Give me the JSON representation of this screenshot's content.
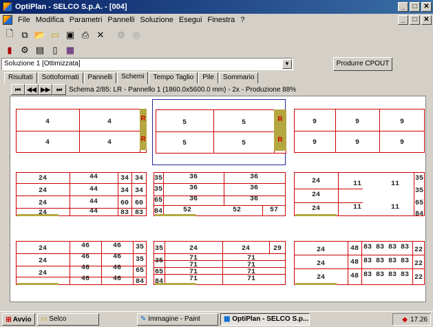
{
  "window": {
    "title": "OptiPlan - SELCO S.p.A. - [004]",
    "minimize": "_",
    "maximize": "□",
    "close": "✕"
  },
  "menu": [
    "File",
    "Modifica",
    "Parametri",
    "Pannelli",
    "Soluzione",
    "Esegui",
    "Finestra",
    "?"
  ],
  "toolbar1": [
    "new-icon",
    "copy-icon",
    "open-icon",
    "folder-icon",
    "save-icon",
    "print-icon",
    "delete-icon",
    "gear-disabled-icon",
    "circle-disabled-icon"
  ],
  "toolbar2": [
    "book-icon",
    "gear-icon",
    "monitor-icon",
    "document-icon",
    "chart-icon"
  ],
  "solution": {
    "selected": "Soluzione 1 [Ottimizzata]",
    "cpout_label": "Produrre CPOUT"
  },
  "tabs": [
    "Risultati",
    "Sottoformati",
    "Pannelli",
    "Schemi",
    "Tempo Taglio",
    "Pile",
    "Sommario"
  ],
  "active_tab": "Schemi",
  "nav": {
    "first": "⏮",
    "prev": "◀◀",
    "next": "▶▶",
    "last": "⏭",
    "info": "Schema 2/85: LR - Pannello 1 (1860.0x5600.0 mm) - 2x - Produzione 88%"
  },
  "schemes": [
    {
      "labels": [
        "4",
        "4",
        "R",
        "4",
        "4",
        "R"
      ]
    },
    {
      "labels": [
        "5",
        "5",
        "R",
        "5",
        "5",
        "R"
      ]
    },
    {
      "labels": [
        "9",
        "9",
        "9",
        "9",
        "9",
        "9"
      ]
    },
    {
      "labels": [
        "24",
        "44",
        "34",
        "34",
        "24",
        "44",
        "34",
        "34",
        "24",
        "44",
        "60",
        "60",
        "24",
        "44",
        "83",
        "83"
      ]
    },
    {
      "labels": [
        "35",
        "36",
        "36",
        "35",
        "36",
        "36",
        "65",
        "36",
        "36",
        "84",
        "52",
        "52",
        "57"
      ]
    },
    {
      "labels": [
        "24",
        "11",
        "11",
        "35",
        "24",
        "35",
        "24",
        "11",
        "11",
        "65",
        "84"
      ]
    },
    {
      "labels": [
        "24",
        "46",
        "46",
        "35",
        "24",
        "46",
        "46",
        "35",
        "46",
        "46",
        "65",
        "24",
        "46",
        "46",
        "84"
      ]
    },
    {
      "labels": [
        "35",
        "24",
        "24",
        "29",
        "35",
        "71",
        "71",
        "71",
        "71",
        "65",
        "71",
        "71",
        "84",
        "71",
        "71"
      ]
    },
    {
      "labels": [
        "24",
        "48",
        "83",
        "83",
        "83",
        "83",
        "22",
        "24",
        "48",
        "83",
        "83",
        "83",
        "83",
        "22",
        "24",
        "48",
        "83",
        "83",
        "83",
        "83",
        "22"
      ]
    }
  ],
  "taskbar": {
    "start": "Avvio",
    "tasks": [
      "Selco",
      "Immagine - Paint",
      "OptiPlan - SELCO S.p..."
    ],
    "clock": "17.26"
  }
}
